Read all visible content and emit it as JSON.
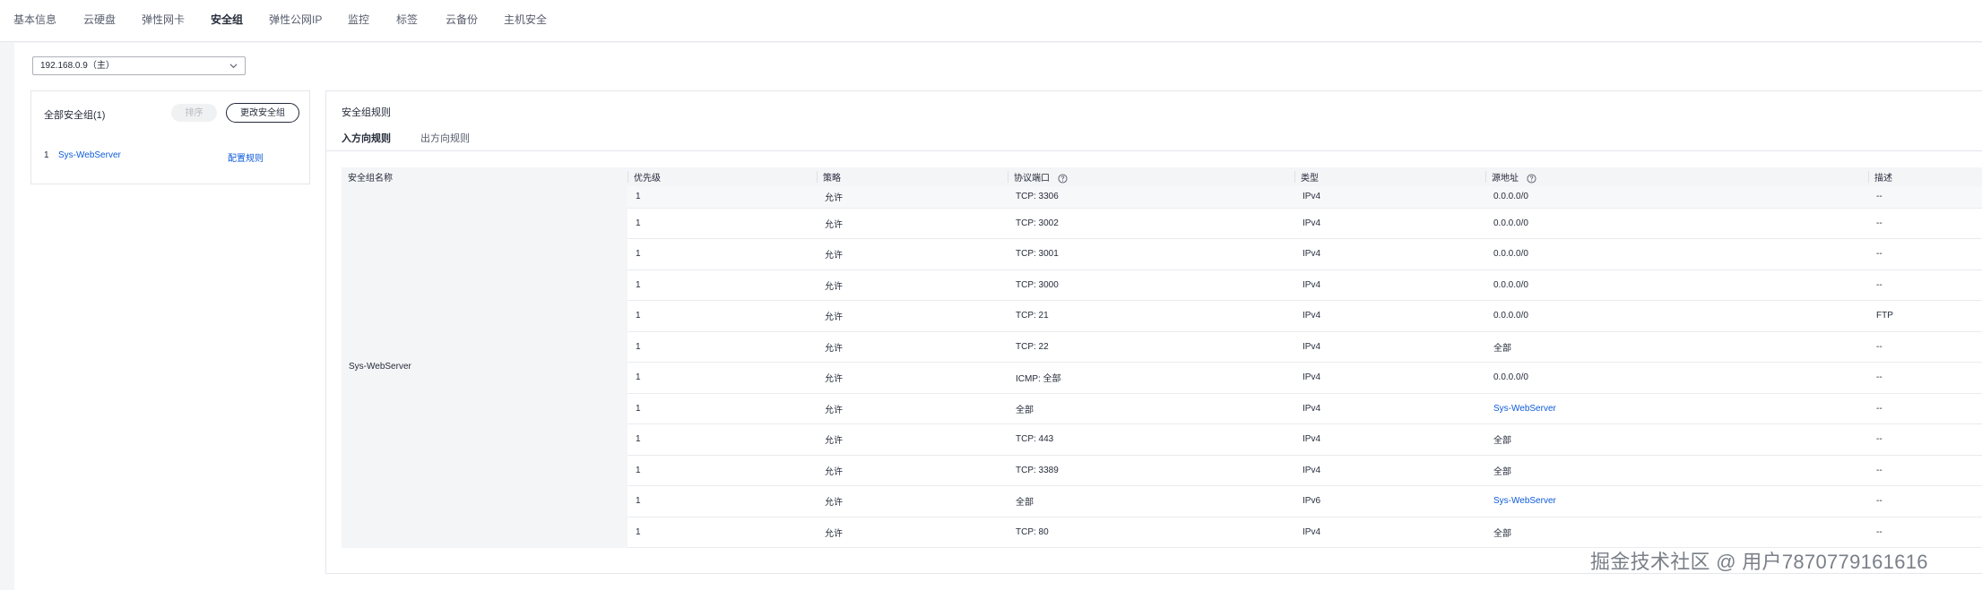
{
  "tabs": [
    {
      "label": "基本信息",
      "active": false
    },
    {
      "label": "云硬盘",
      "active": false
    },
    {
      "label": "弹性网卡",
      "active": false
    },
    {
      "label": "安全组",
      "active": true
    },
    {
      "label": "弹性公网IP",
      "active": false
    },
    {
      "label": "监控",
      "active": false
    },
    {
      "label": "标签",
      "active": false
    },
    {
      "label": "云备份",
      "active": false
    },
    {
      "label": "主机安全",
      "active": false
    }
  ],
  "nic_select": {
    "value": "192.168.0.9（主）"
  },
  "sg_panel": {
    "title": "全部安全组(1)",
    "sort_button": "排序",
    "change_button": "更改安全组",
    "items": [
      {
        "no": "1",
        "name": "Sys-WebServer",
        "action": "配置规则"
      }
    ]
  },
  "rules": {
    "title": "安全组规则",
    "subtabs": {
      "inbound": "入方向规则",
      "outbound": "出方向规则"
    },
    "columns": {
      "name": "安全组名称",
      "priority": "优先级",
      "policy": "策略",
      "protocol_port": "协议端口",
      "type": "类型",
      "source": "源地址",
      "desc": "描述"
    },
    "group_name": "Sys-WebServer",
    "rows": [
      {
        "priority": "1",
        "policy": "允许",
        "protocol_port": "TCP: 3306",
        "type": "IPv4",
        "source": "0.0.0.0/0",
        "source_link": false,
        "desc": "--"
      },
      {
        "priority": "1",
        "policy": "允许",
        "protocol_port": "TCP: 3002",
        "type": "IPv4",
        "source": "0.0.0.0/0",
        "source_link": false,
        "desc": "--"
      },
      {
        "priority": "1",
        "policy": "允许",
        "protocol_port": "TCP: 3001",
        "type": "IPv4",
        "source": "0.0.0.0/0",
        "source_link": false,
        "desc": "--"
      },
      {
        "priority": "1",
        "policy": "允许",
        "protocol_port": "TCP: 3000",
        "type": "IPv4",
        "source": "0.0.0.0/0",
        "source_link": false,
        "desc": "--"
      },
      {
        "priority": "1",
        "policy": "允许",
        "protocol_port": "TCP: 21",
        "type": "IPv4",
        "source": "0.0.0.0/0",
        "source_link": false,
        "desc": "FTP"
      },
      {
        "priority": "1",
        "policy": "允许",
        "protocol_port": "TCP: 22",
        "type": "IPv4",
        "source": "全部",
        "source_link": false,
        "desc": "--"
      },
      {
        "priority": "1",
        "policy": "允许",
        "protocol_port": "ICMP: 全部",
        "type": "IPv4",
        "source": "0.0.0.0/0",
        "source_link": false,
        "desc": "--"
      },
      {
        "priority": "1",
        "policy": "允许",
        "protocol_port": "全部",
        "type": "IPv4",
        "source": "Sys-WebServer",
        "source_link": true,
        "desc": "--"
      },
      {
        "priority": "1",
        "policy": "允许",
        "protocol_port": "TCP: 443",
        "type": "IPv4",
        "source": "全部",
        "source_link": false,
        "desc": "--"
      },
      {
        "priority": "1",
        "policy": "允许",
        "protocol_port": "TCP: 3389",
        "type": "IPv4",
        "source": "全部",
        "source_link": false,
        "desc": "--"
      },
      {
        "priority": "1",
        "policy": "允许",
        "protocol_port": "全部",
        "type": "IPv6",
        "source": "Sys-WebServer",
        "source_link": true,
        "desc": "--"
      },
      {
        "priority": "1",
        "policy": "允许",
        "protocol_port": "TCP: 80",
        "type": "IPv4",
        "source": "全部",
        "source_link": false,
        "desc": "--"
      }
    ]
  },
  "watermark": "掘金技术社区 @ 用户7870779161616",
  "colors": {
    "link": "#0d5bd9",
    "header_bg": "#f4f5f7",
    "text": "#252b3a"
  },
  "icons": [
    "chevron-down-icon",
    "help-circle-icon"
  ]
}
